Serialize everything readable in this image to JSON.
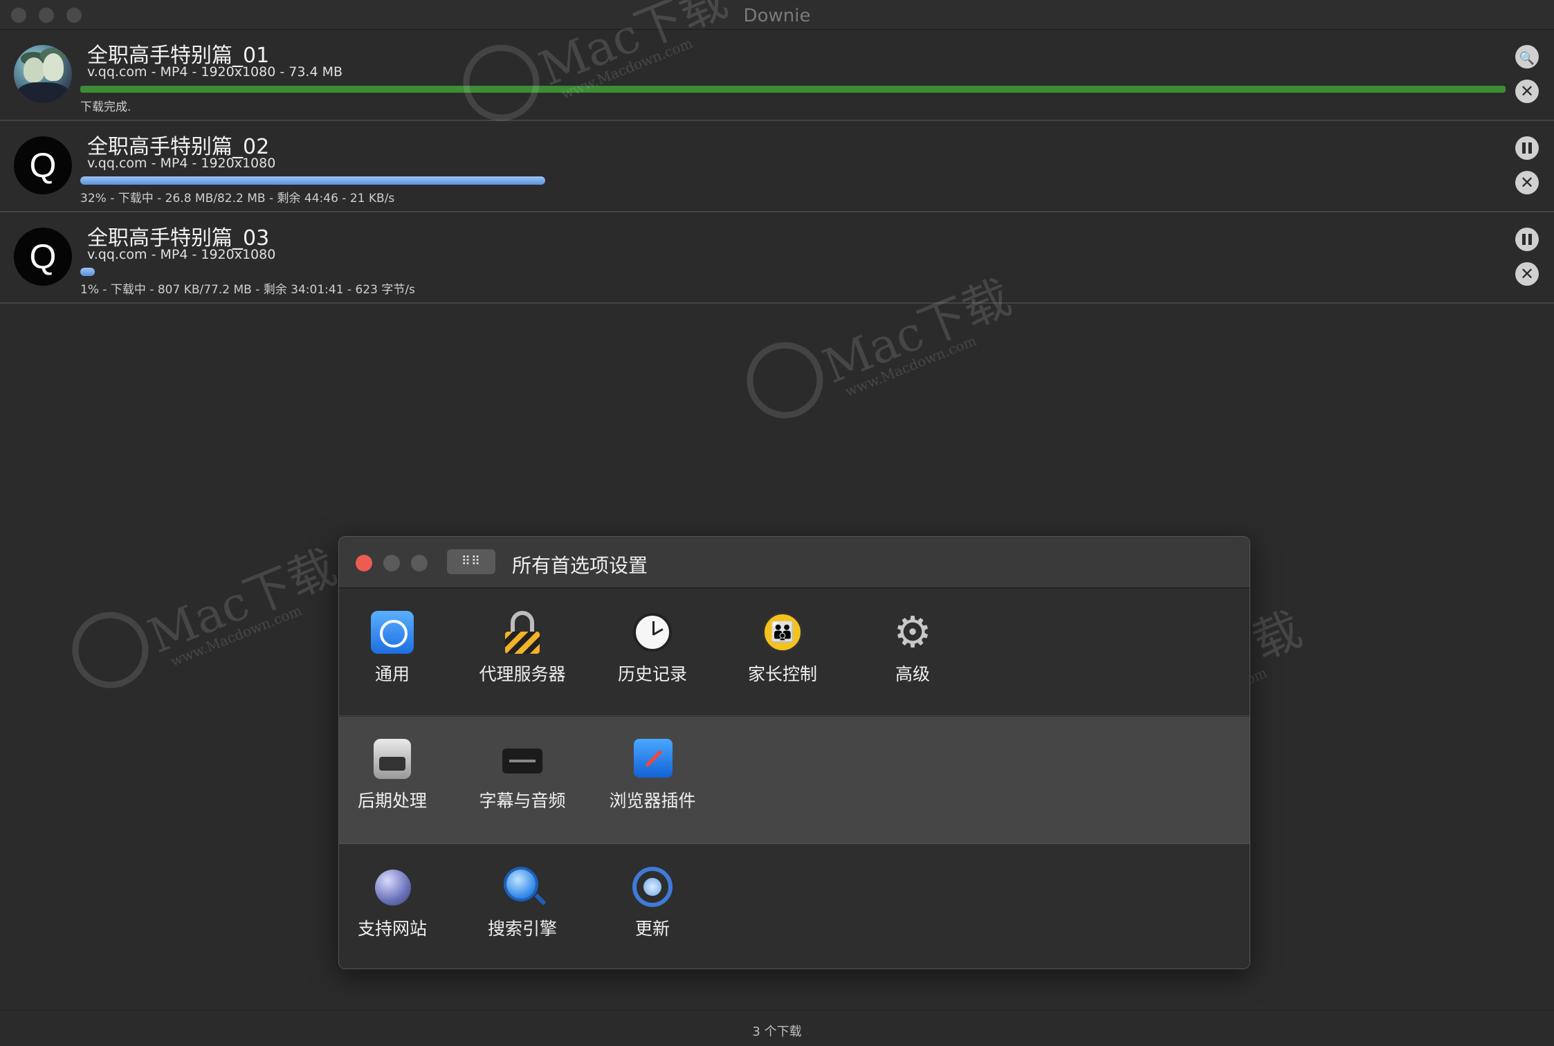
{
  "window": {
    "title": "Downie"
  },
  "downloads": [
    {
      "title": "全职高手特别篇_01",
      "meta": "v.qq.com - MP4 - 1920x1080 - 73.4 MB",
      "status": "下载完成.",
      "progress": 1.0,
      "state": "complete",
      "avatar": "anime-thumbnail"
    },
    {
      "title": "全职高手特别篇_02",
      "meta": "v.qq.com - MP4 - 1920x1080",
      "status": "32% - 下载中 - 26.8 MB/82.2 MB - 剩余 44:46 - 21 KB/s",
      "progress": 0.32,
      "state": "downloading",
      "avatar": "Q"
    },
    {
      "title": "全职高手特别篇_03",
      "meta": "v.qq.com - MP4 - 1920x1080",
      "status": "1% - 下载中 - 807 KB/77.2 MB - 剩余 34:01:41 - 623 字节/s",
      "progress": 0.01,
      "state": "downloading",
      "avatar": "Q"
    }
  ],
  "footer": {
    "count_text": "3 个下载"
  },
  "preferences": {
    "title": "所有首选项设置",
    "grid_button": "⠿⠿",
    "rows": [
      [
        {
          "label": "通用",
          "icon": "general-icon"
        },
        {
          "label": "代理服务器",
          "icon": "lock-icon"
        },
        {
          "label": "历史记录",
          "icon": "clock-icon"
        },
        {
          "label": "家长控制",
          "icon": "parental-control-icon"
        },
        {
          "label": "高级",
          "icon": "gear-icon"
        }
      ],
      [
        {
          "label": "后期处理",
          "icon": "robot-icon"
        },
        {
          "label": "字幕与音频",
          "icon": "subtitle-icon"
        },
        {
          "label": "浏览器插件",
          "icon": "compass-icon"
        }
      ],
      [
        {
          "label": "支持网站",
          "icon": "globe-icon"
        },
        {
          "label": "搜索引擎",
          "icon": "search-icon"
        },
        {
          "label": "更新",
          "icon": "update-icon"
        }
      ]
    ]
  },
  "icons": {
    "search": "🔍",
    "close": "✕",
    "parental_glyph": "👪",
    "gear_glyph": "⚙"
  },
  "colors": {
    "complete_bar": "#3c8d35",
    "progress_bar": "#5a93dc",
    "close_red": "#ee5b52"
  },
  "watermark": {
    "text": "Mac下载",
    "url": "www.Macdown.com"
  }
}
